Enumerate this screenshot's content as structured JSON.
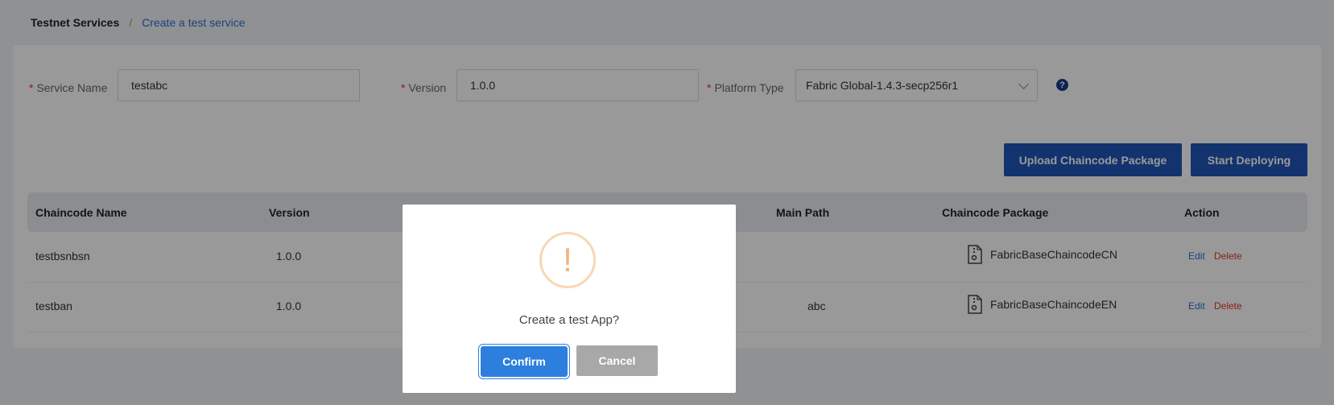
{
  "breadcrumb": {
    "root": "Testnet Services",
    "separator": "/",
    "current": "Create a test service"
  },
  "form": {
    "service_name": {
      "label": "Service Name",
      "value": "testabc"
    },
    "version": {
      "label": "Version",
      "value": "1.0.0"
    },
    "platform_type": {
      "label": "Platform Type",
      "value": "Fabric Global-1.4.3-secp256r1"
    },
    "required_mark": "*",
    "help_glyph": "?"
  },
  "buttons": {
    "upload": "Upload Chaincode Package",
    "deploy": "Start Deploying"
  },
  "table": {
    "headers": [
      "Chaincode Name",
      "Version",
      "Main Path",
      "Chaincode Package",
      "Action"
    ],
    "rows": [
      {
        "name": "testbsnbsn",
        "version": "1.0.0",
        "main_path": "",
        "package": "FabricBaseChaincodeCN",
        "edit": "Edit",
        "delete": "Delete"
      },
      {
        "name": "testban",
        "version": "1.0.0",
        "main_path": "abc",
        "package": "FabricBaseChaincodeEN",
        "edit": "Edit",
        "delete": "Delete"
      }
    ]
  },
  "dialog": {
    "icon_glyph": "!",
    "message": "Create a test App?",
    "confirm": "Confirm",
    "cancel": "Cancel"
  },
  "colors": {
    "primary": "#1f56b8",
    "link": "#2f6fd6",
    "danger": "#e0362c",
    "warning": "#f5b27a",
    "confirm": "#2d7fde"
  },
  "icons": {
    "help": "question-circle-icon",
    "file": "file-zip-icon",
    "warning": "exclamation-circle-icon",
    "dropdown": "chevron-down-icon"
  }
}
